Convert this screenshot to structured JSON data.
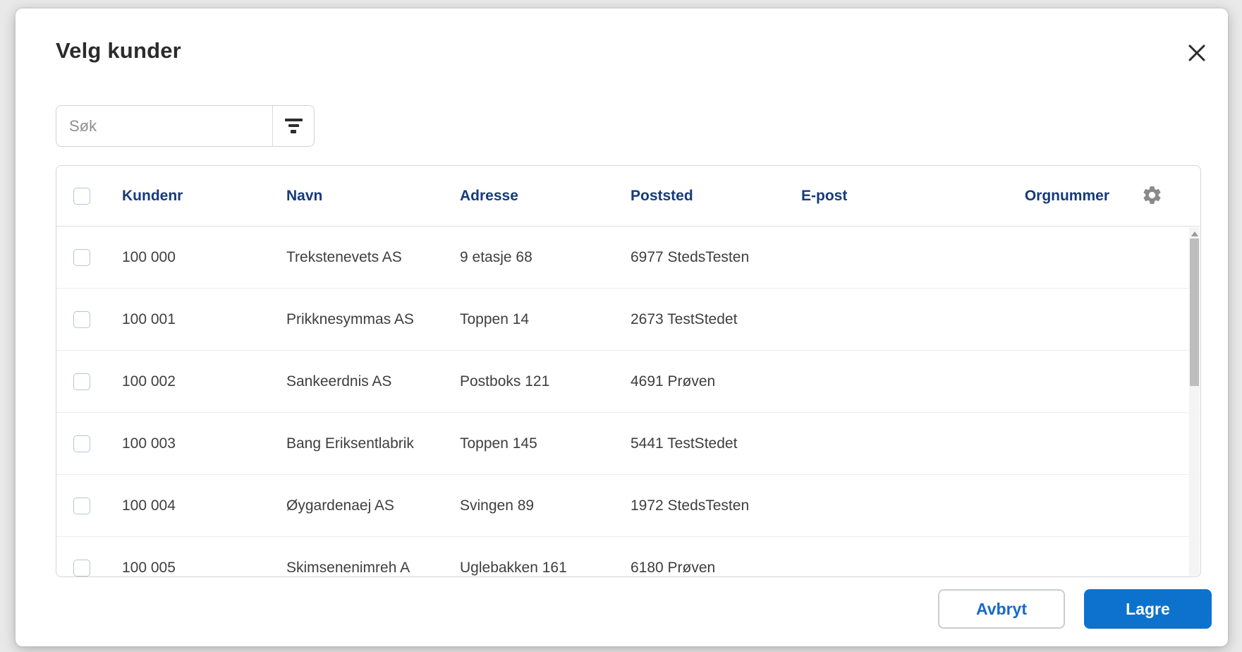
{
  "dialog": {
    "title": "Velg kunder"
  },
  "search": {
    "placeholder": "Søk",
    "value": ""
  },
  "table": {
    "columns": {
      "kundenr": "Kundenr",
      "navn": "Navn",
      "adresse": "Adresse",
      "poststed": "Poststed",
      "epost": "E-post",
      "orgnummer": "Orgnummer"
    },
    "header_checkbox_checked": false,
    "rows": [
      {
        "checked": false,
        "kundenr": "100 000",
        "navn": "Trekstenevets AS",
        "adresse": "9 etasje 68",
        "poststed": "6977 StedsTesten",
        "epost": "",
        "orgnummer": ""
      },
      {
        "checked": false,
        "kundenr": "100 001",
        "navn": "Prikknesymmas AS",
        "adresse": "Toppen 14",
        "poststed": "2673 TestStedet",
        "epost": "",
        "orgnummer": ""
      },
      {
        "checked": false,
        "kundenr": "100 002",
        "navn": "Sankeerdnis AS",
        "adresse": "Postboks 121",
        "poststed": "4691 Prøven",
        "epost": "",
        "orgnummer": ""
      },
      {
        "checked": false,
        "kundenr": "100 003",
        "navn": "Bang Eriksentlabrik",
        "adresse": "Toppen 145",
        "poststed": "5441 TestStedet",
        "epost": "",
        "orgnummer": ""
      },
      {
        "checked": false,
        "kundenr": "100 004",
        "navn": "Øygardenaej AS",
        "adresse": "Svingen 89",
        "poststed": "1972 StedsTesten",
        "epost": "",
        "orgnummer": ""
      },
      {
        "checked": false,
        "kundenr": "100 005",
        "navn": "Skimsenenimreh A",
        "adresse": "Uglebakken 161",
        "poststed": "6180 Prøven",
        "epost": "",
        "orgnummer": ""
      }
    ]
  },
  "footer": {
    "cancel_label": "Avbryt",
    "save_label": "Lagre"
  },
  "icons": {
    "close": "x-cross",
    "filter": "three-decreasing-bars",
    "settings": "solid-gear",
    "scroll_up": "triangle-up"
  },
  "colors": {
    "save_button_bg": "#0d72ce",
    "cancel_button_text": "#1569c8",
    "column_header_text": "#163a7d",
    "row_text": "#3e3e3e",
    "checkbox_border": "#b7c3dc"
  }
}
